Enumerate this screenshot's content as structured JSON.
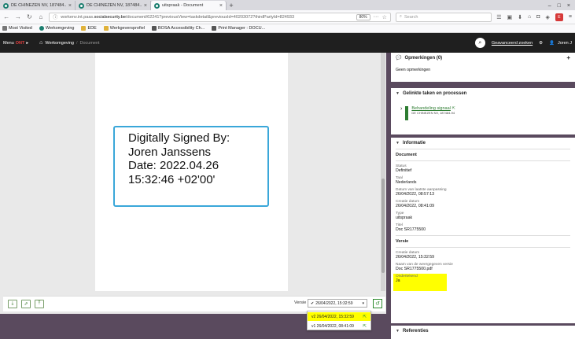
{
  "browser": {
    "tabs": [
      {
        "label": "DE CHINEZEN NV, 187484...",
        "active": false
      },
      {
        "label": "DE CHINEZEN NV, 187484...",
        "active": false
      },
      {
        "label": "uitspraak - Document",
        "active": true
      }
    ],
    "url_prefix": "workenv.int.paas.",
    "url_domain": "socialsecurity.be",
    "url_suffix": "/document/62241?previousView=taskdetail&previousId=40203072?thirdPartyId=824933",
    "zoom": "80%",
    "search_placeholder": "Search",
    "bookmarks": [
      {
        "label": "Most Visited",
        "color": "#777777"
      },
      {
        "label": "Werkomgeving",
        "color": "#1b7e6f"
      },
      {
        "label": "EDE",
        "color": "#e0b23a"
      },
      {
        "label": "Werkgeversprofiel",
        "color": "#e0b23a"
      },
      {
        "label": "BOSA Accessibility Ch...",
        "color": "#555555"
      },
      {
        "label": "Print Manager : DOCU...",
        "color": "#555555"
      }
    ]
  },
  "header": {
    "menu_label": "Menu",
    "menu_accent": "ONT",
    "crumb_home": "Werkomgeving",
    "crumb_doc": "Document",
    "advanced_search": "Geavanceerd zoeken",
    "user": "Joren J"
  },
  "document": {
    "signature_lines": [
      "Digitally Signed By:",
      "Joren Janssens",
      "Date: 2022.04.26",
      "15:32:46 +02'00'"
    ]
  },
  "footer": {
    "version_label": "Versie",
    "selected_version": "26/04/2022, 15:32:59",
    "options": [
      {
        "label": "v2  26/04/2022, 15:32:59",
        "highlight": true
      },
      {
        "label": "v1  26/04/2022, 08:41:09",
        "highlight": false
      }
    ]
  },
  "panel": {
    "remarks": {
      "title": "Opmerkingen (0)",
      "empty": "Geen opmerkingen"
    },
    "linked": {
      "title": "Gelinkte taken en processen",
      "link": "Behandeling signaal",
      "sub": "DE CHINEZEN NV, 187484-94"
    },
    "info": {
      "title": "Informatie",
      "doc_group": "Document",
      "fields": [
        {
          "label": "Status",
          "value": "Definitief"
        },
        {
          "label": "Taal",
          "value": "Nederlands"
        },
        {
          "label": "Datum van laatste aanpassing",
          "value": "26/04/2022, 08:57:13"
        },
        {
          "label": "Creatie datum",
          "value": "26/04/2022, 08:41:09"
        },
        {
          "label": "Type",
          "value": "uitspraak"
        },
        {
          "label": "Titel",
          "value": "Doc SR1775500"
        }
      ],
      "version_group": "Versie",
      "version_fields": [
        {
          "label": "Creatie datum",
          "value": "26/04/2022, 15:32:59"
        },
        {
          "label": "Naam van de weergegeven versie",
          "value": "Doc SR1775500.pdf"
        },
        {
          "label": "Ondertekend",
          "value": "Ja"
        }
      ]
    },
    "references": {
      "title": "Referenties"
    }
  }
}
